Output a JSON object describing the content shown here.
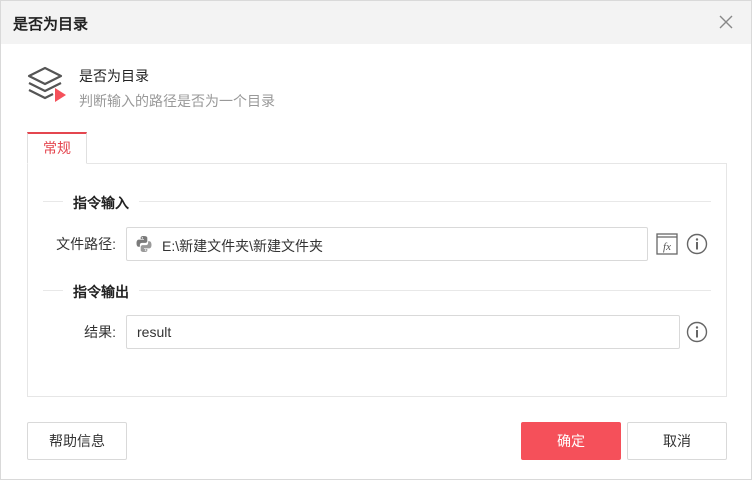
{
  "dialog": {
    "title": "是否为目录",
    "close_icon": "close-icon"
  },
  "header": {
    "icon": "layers-play-icon",
    "name": "是否为目录",
    "description": "判断输入的路径是否为一个目录"
  },
  "tabs": [
    {
      "label": "常规",
      "active": true
    }
  ],
  "input_section": {
    "title": "指令输入",
    "fields": [
      {
        "label": "文件路径:",
        "value": "E:\\新建文件夹\\新建文件夹",
        "prefix_icon": "python-icon"
      }
    ]
  },
  "output_section": {
    "title": "指令输出",
    "fields": [
      {
        "label": "结果:",
        "value": "result"
      }
    ]
  },
  "buttons": {
    "help": "帮助信息",
    "ok": "确定",
    "cancel": "取消"
  },
  "colors": {
    "accent": "#f5505a",
    "tab_accent": "#e4464f",
    "titlebar_bg": "#f3f3f3"
  }
}
